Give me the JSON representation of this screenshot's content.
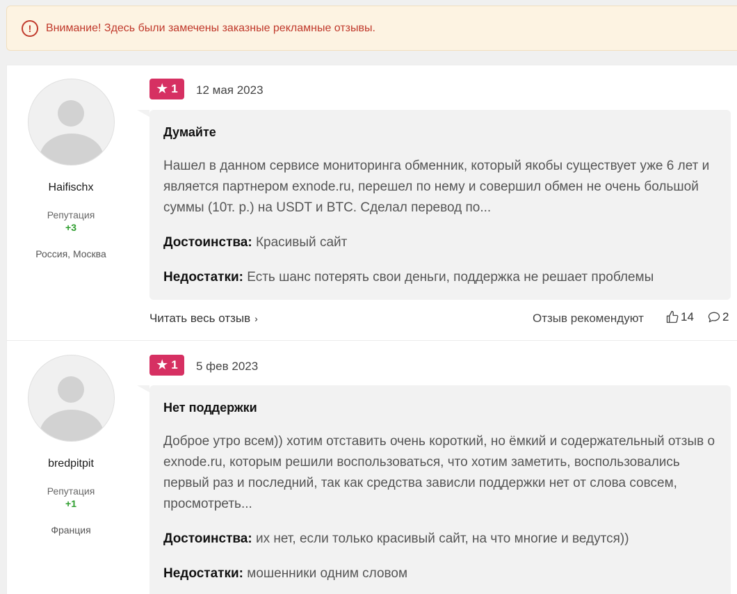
{
  "alert": {
    "icon": "exclamation-circle-icon",
    "text": "Внимание! Здесь были замечены заказные рекламные отзывы."
  },
  "reviews": [
    {
      "author": {
        "name": "Haifischx",
        "rep_label": "Репутация",
        "rep_value": "+3",
        "location": "Россия, Москва"
      },
      "rating": "1",
      "date": "12 мая 2023",
      "title": "Думайте",
      "text": "Нашел в данном сервисе мониторинга обменник, который якобы существует уже 6 лет и является партнером exnode.ru, перешел по нему и совершил обмен не очень большой суммы (10т. р.) на USDT и BTC. Сделал перевод по...",
      "pros_label": "Достоинства:",
      "pros": "Красивый сайт",
      "cons_label": "Недостатки:",
      "cons": "Есть шанс потерять свои деньги, поддержка не решает проблемы",
      "read_more": "Читать весь отзыв",
      "recommend": "Отзыв рекомендуют",
      "likes": "14",
      "comments": "2"
    },
    {
      "author": {
        "name": "bredpitpit",
        "rep_label": "Репутация",
        "rep_value": "+1",
        "location": "Франция"
      },
      "rating": "1",
      "date": "5 фев 2023",
      "title": "Нет поддержки",
      "text": "Доброе утро всем)) хотим отставить очень короткий, но ёмкий и содержательный отзыв о exnode.ru, которым решили воспользоваться, что хотим заметить, воспользовались первый раз и последний, так как средства зависли поддержки нет от слова совсем, просмотреть...",
      "pros_label": "Достоинства:",
      "pros": "их нет, если только красивый сайт, на что многие и ведутся))",
      "cons_label": "Недостатки:",
      "cons": "мошенники одним словом"
    }
  ],
  "colors": {
    "accent": "#d63062",
    "alert_text": "#c0392b",
    "alert_bg": "#fdf3e2",
    "reputation": "#2e9e2e"
  }
}
